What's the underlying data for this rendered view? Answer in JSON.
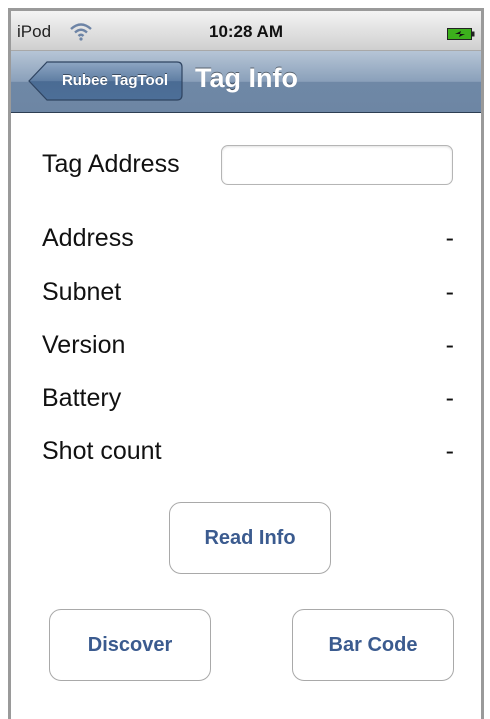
{
  "status_bar": {
    "carrier": "iPod",
    "time": "10:28 AM",
    "wifi_icon": "wifi-icon",
    "battery_icon": "battery-charging-icon"
  },
  "nav": {
    "back_label": "Rubee TagTool",
    "title": "Tag Info"
  },
  "form": {
    "tag_address_label": "Tag Address",
    "tag_address_value": "",
    "tag_address_placeholder": ""
  },
  "info_rows": [
    {
      "label": "Address",
      "value": "-"
    },
    {
      "label": "Subnet",
      "value": "-"
    },
    {
      "label": "Version",
      "value": "-"
    },
    {
      "label": "Battery",
      "value": "-"
    },
    {
      "label": "Shot count",
      "value": "-"
    }
  ],
  "buttons": {
    "read_info": "Read Info",
    "discover": "Discover",
    "bar_code": "Bar Code"
  },
  "colors": {
    "nav_bar": "#7f96b2",
    "button_text": "#3b5b8f",
    "battery_fill": "#3cb01c"
  }
}
